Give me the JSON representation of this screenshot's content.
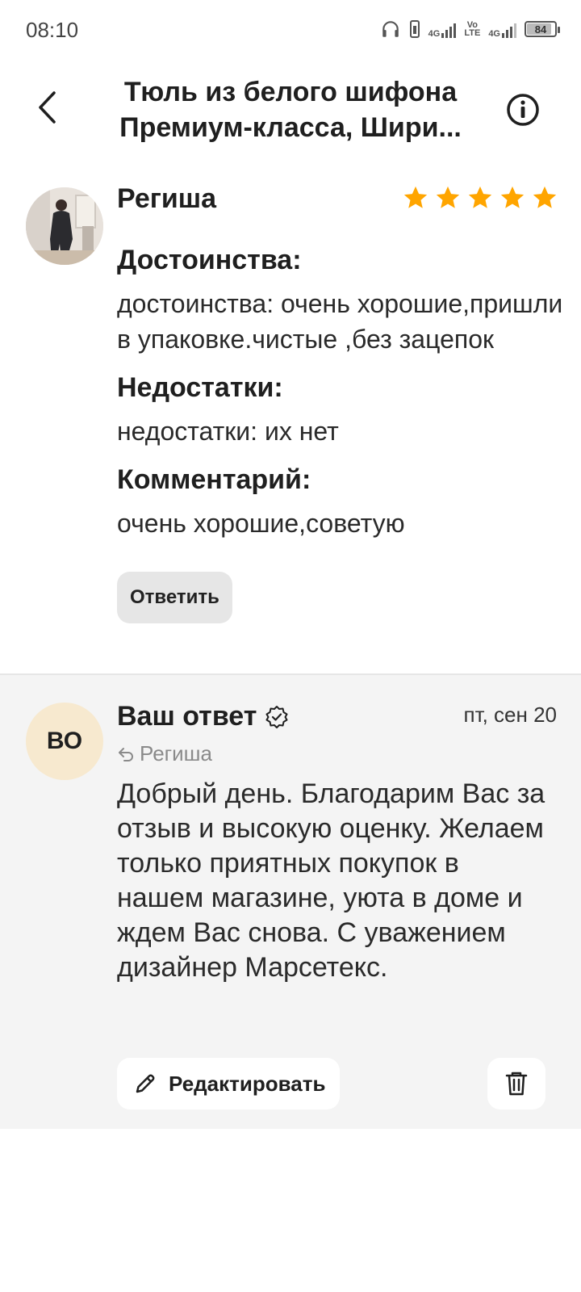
{
  "status_bar": {
    "time": "08:10",
    "net1": "4G",
    "net2_top": "Vo",
    "net2_bottom": "LTE",
    "net3": "4G",
    "battery": "84"
  },
  "header": {
    "title": "Тюль из белого шифона Премиум-класса, Шири..."
  },
  "review": {
    "author": "Региша",
    "rating": 5,
    "rating_color": "#FFA500",
    "sections": [
      {
        "title": "Достоинства:",
        "text": "достоинства: очень хорошие,пришли в упаковке.чистые ,без зацепок"
      },
      {
        "title": "Недостатки:",
        "text": "недостатки: их нет"
      },
      {
        "title": "Комментарий:",
        "text": "очень хорошие,советую"
      }
    ],
    "reply_button": "Ответить"
  },
  "answer": {
    "avatar_initials": "ВО",
    "title": "Ваш ответ",
    "date": "пт, сен 20",
    "reply_to": "Региша",
    "text": "Добрый день. Благодарим Вас за отзыв и высокую оценку. Желаем только приятных покупок в нашем магазине, уюта в доме и ждем Вас снова. С уважением дизайнер Марсетекс.",
    "edit_button": "Редактировать"
  },
  "icons": {
    "back": "chevron-left-icon",
    "info": "info-icon",
    "star": "star-icon",
    "verified": "verified-check-icon",
    "reply_arrow": "reply-arrow-icon",
    "edit": "pencil-icon",
    "delete": "trash-icon"
  },
  "colors": {
    "accent_star": "#FFA500",
    "answer_background": "#F4F4F4",
    "avatar_initials_bg": "#F7E9CF"
  }
}
